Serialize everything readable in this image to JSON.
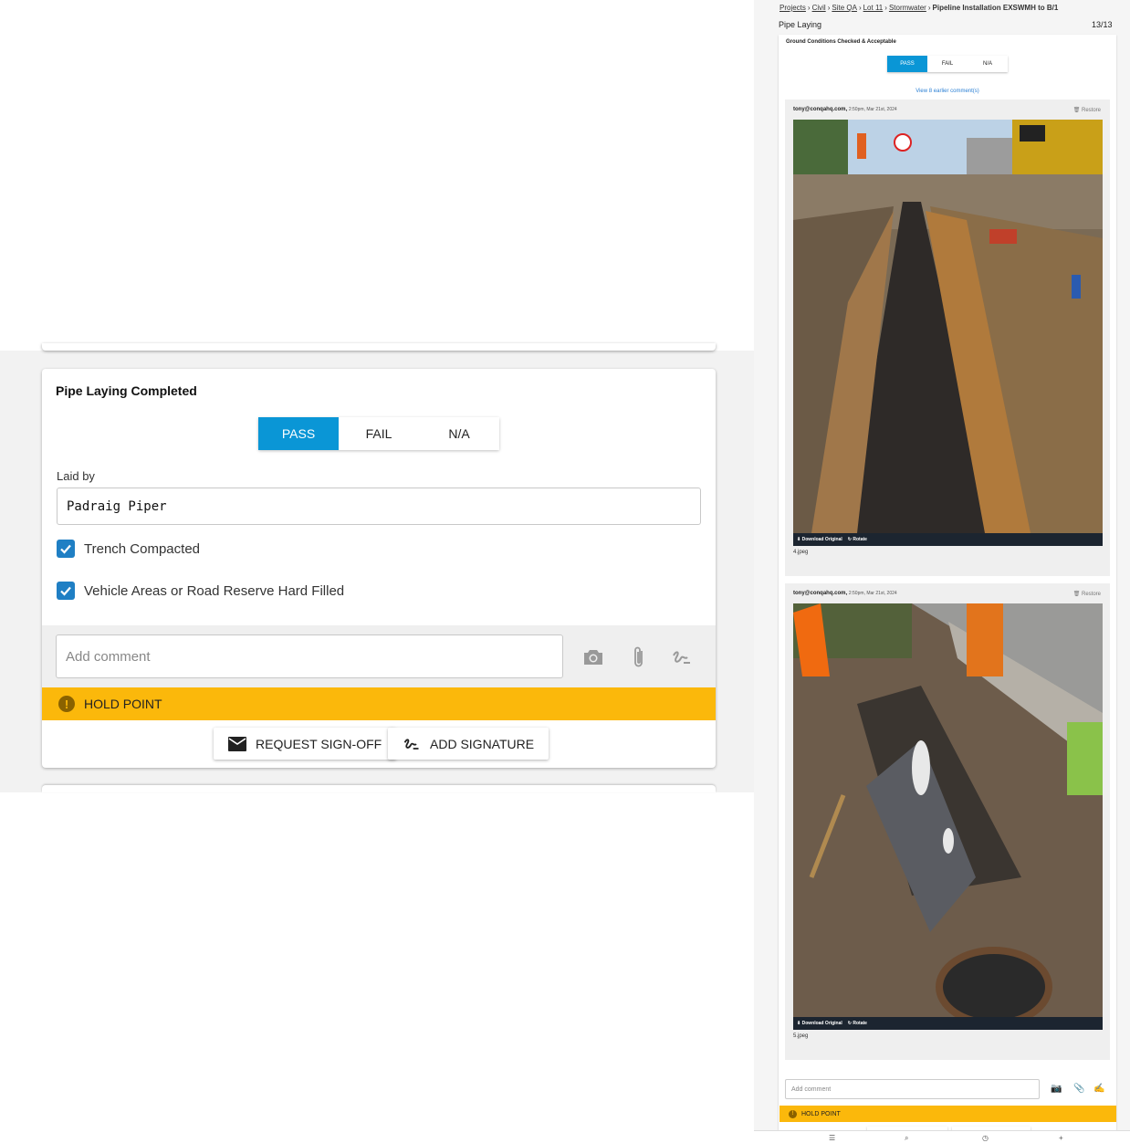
{
  "zoom": {
    "card_title": "Pipe Laying Completed",
    "options": [
      "PASS",
      "FAIL",
      "N/A"
    ],
    "selected_option": "PASS",
    "laid_by_label": "Laid by",
    "laid_by_value": "Padraig Piper",
    "checks": [
      {
        "label": "Trench Compacted",
        "checked": true
      },
      {
        "label": "Vehicle Areas or Road Reserve Hard Filled",
        "checked": true
      }
    ],
    "comment_placeholder": "Add comment",
    "tools": [
      "camera-icon",
      "paperclip-icon",
      "signature-icon"
    ],
    "hold_point": "HOLD POINT",
    "request_signoff": "REQUEST SIGN-OFF",
    "add_signature": "ADD SIGNATURE",
    "colors": {
      "accent": "#0a96d6",
      "hold": "#fbb80b",
      "checkbox": "#1f7fc4"
    }
  },
  "page": {
    "breadcrumb": [
      "Projects",
      "Civil",
      "Site QA",
      "Lot 11",
      "Stormwater"
    ],
    "breadcrumb_current": "Pipeline Installation EXSWMH to B/1",
    "section_title": "Pipe Laying",
    "counter": "13/13",
    "item_heading": "Ground Conditions Checked & Acceptable",
    "options": [
      "PASS",
      "FAIL",
      "N/A"
    ],
    "earlier_comments": "View 8 earlier comment(s)",
    "comments": [
      {
        "author": "tony@conqahq.com,",
        "time": "2:50pm, Mar 21st, 2024",
        "restore": "Restore",
        "download": "Download Original",
        "rotate": "Rotate",
        "file": "4.jpeg"
      },
      {
        "author": "tony@conqahq.com,",
        "time": "2:50pm, Mar 21st, 2024",
        "restore": "Restore",
        "download": "Download Original",
        "rotate": "Rotate",
        "file": "5.jpeg"
      }
    ],
    "comment_placeholder": "Add comment",
    "hold_point": "HOLD POINT"
  }
}
